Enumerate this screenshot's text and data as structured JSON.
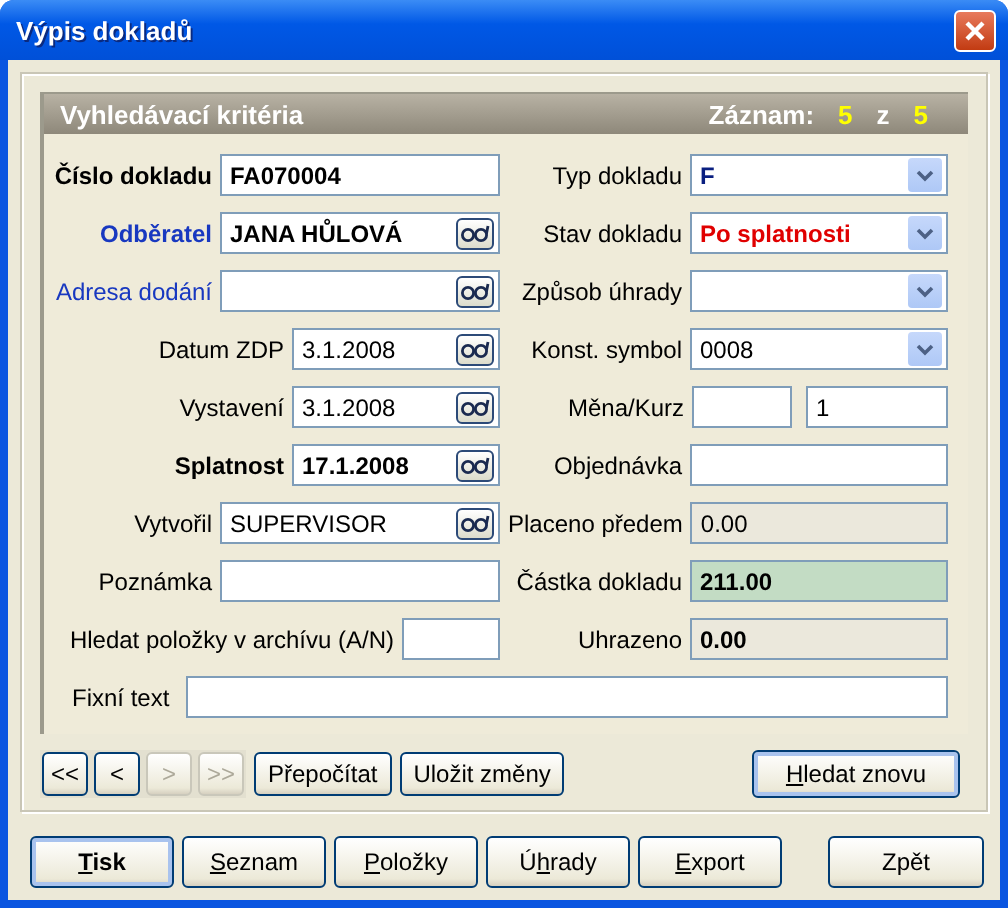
{
  "window": {
    "title": "Výpis dokladů"
  },
  "criteria": {
    "title": "Vyhledávací kritéria",
    "record_label": "Záznam:",
    "record_current": "5",
    "record_of": "z",
    "record_total": "5"
  },
  "left_fields": [
    {
      "label": "Číslo dokladu",
      "label_bold": true,
      "label_link": false,
      "value": "FA070004",
      "value_bold": true,
      "kind": "text"
    },
    {
      "label": "Odběratel",
      "label_bold": true,
      "label_link": true,
      "value": "JANA HŮLOVÁ",
      "value_bold": true,
      "kind": "lookup"
    },
    {
      "label": "Adresa dodání",
      "label_bold": false,
      "label_link": true,
      "kind": "lookup"
    },
    {
      "label": "Datum ZDP",
      "label_bold": false,
      "label_link": false,
      "value": "3.1.2008",
      "value_bold": false,
      "kind": "date"
    },
    {
      "label": "Vystavení",
      "label_bold": false,
      "label_link": false,
      "value": "3.1.2008",
      "value_bold": false,
      "kind": "date"
    },
    {
      "label": "Splatnost",
      "label_bold": true,
      "label_link": false,
      "value": "17.1.2008",
      "value_bold": true,
      "kind": "date"
    },
    {
      "label": "Vytvořil",
      "label_bold": false,
      "label_link": false,
      "value": "SUPERVISOR",
      "value_bold": false,
      "kind": "lookup"
    },
    {
      "label": "Poznámka",
      "label_bold": false,
      "label_link": false,
      "kind": "text"
    },
    {
      "label": "Hledat položky v archívu (A/N)",
      "label_bold": false,
      "label_link": false,
      "kind": "tiny"
    }
  ],
  "right_fields": [
    {
      "label": "Typ dokladu",
      "kind": "combo",
      "value": "F",
      "value_bold": true,
      "value_alert": false,
      "value_accent": true
    },
    {
      "label": "Stav dokladu",
      "kind": "combo",
      "value": "Po splatnosti",
      "value_bold": true,
      "value_alert": true,
      "value_accent": false
    },
    {
      "label": "Způsob úhrady",
      "kind": "combo"
    },
    {
      "label": "Konst. symbol",
      "kind": "combo",
      "value": "0008",
      "value_bold": false,
      "value_alert": false,
      "value_accent": false
    },
    {
      "label": "Měna/Kurz",
      "kind": "pair",
      "value_2": "1"
    },
    {
      "label": "Objednávka",
      "kind": "text"
    },
    {
      "label": "Placeno předem",
      "kind": "readonly",
      "value": "0.00",
      "value_bold": false,
      "highlight": false
    },
    {
      "label": "Částka dokladu",
      "kind": "readonly",
      "value": "211.00",
      "value_bold": true,
      "highlight": true
    },
    {
      "label": "Uhrazeno",
      "kind": "readonly",
      "value": "0.00",
      "value_bold": true,
      "highlight": false
    }
  ],
  "fixed_text": {
    "label": "Fixní text"
  },
  "nav_buttons": [
    {
      "label": "<<",
      "disabled": false
    },
    {
      "label": "<",
      "disabled": false
    },
    {
      "label": ">",
      "disabled": true
    },
    {
      "label": ">>",
      "disabled": true
    }
  ],
  "action_buttons": [
    {
      "pre": "Přepočítat",
      "default": false
    },
    {
      "pre": "Uložit změny",
      "default": false
    }
  ],
  "search_button": {
    "key": "H",
    "post": "ledat znovu",
    "default": true
  },
  "footer_buttons": [
    {
      "key": "T",
      "post": "isk",
      "default": true,
      "bold": true
    },
    {
      "key": "S",
      "post": "eznam",
      "default": false,
      "bold": false
    },
    {
      "key": "P",
      "post": "oložky",
      "default": false,
      "bold": false
    },
    {
      "pre": "Ú",
      "key": "h",
      "post": "rady",
      "default": false,
      "bold": false
    },
    {
      "key": "E",
      "post": "xport",
      "default": false,
      "bold": false
    },
    {
      "pre": "Zpět",
      "default": false,
      "bold": false
    }
  ]
}
